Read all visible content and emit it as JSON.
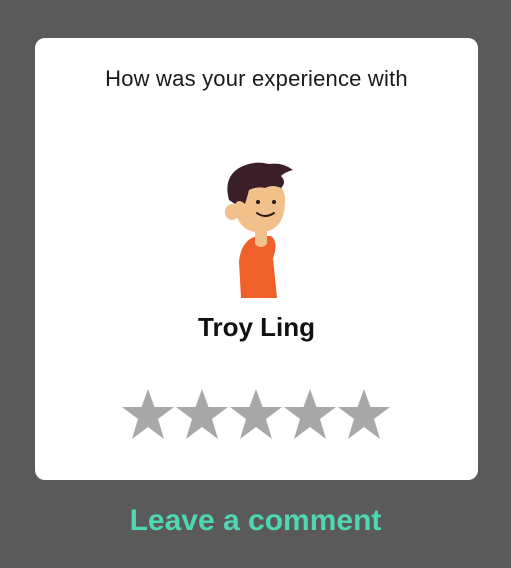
{
  "dialog": {
    "prompt": "How was your experience with",
    "person_name": "Troy Ling",
    "avatar_icon": "person-avatar-illustration",
    "rating": {
      "max": 5,
      "value": 0,
      "empty_color": "#a8a8a8"
    }
  },
  "footer": {
    "comment_label": "Leave a comment",
    "accent_color": "#4fd6b3"
  }
}
